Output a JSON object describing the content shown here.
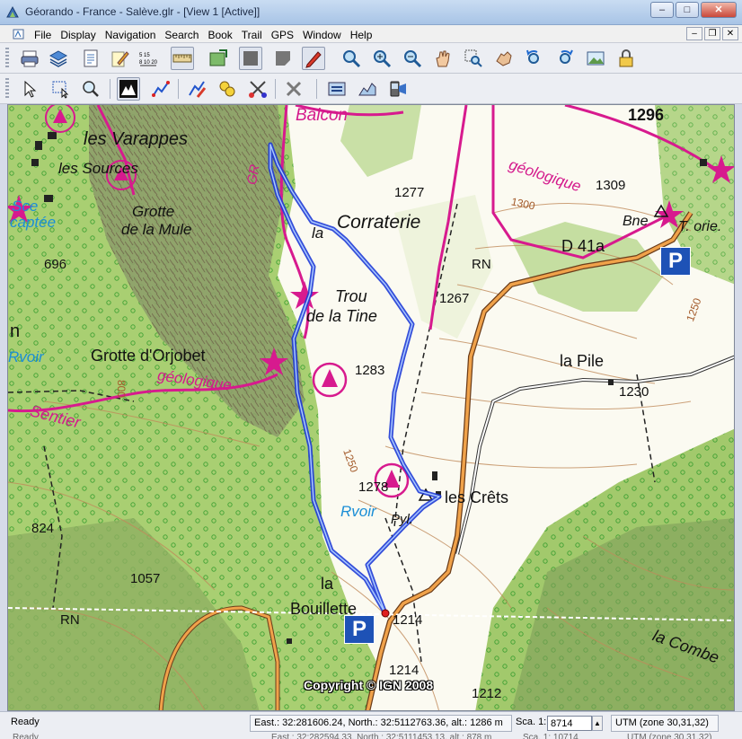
{
  "window": {
    "title": "Géorando - France - Salève.glr - [View 1 [Active]]",
    "minimize": "–",
    "maximize": "□",
    "close": "✕"
  },
  "menubar": {
    "items": [
      "File",
      "Display",
      "Navigation",
      "Search",
      "Book",
      "Trail",
      "GPS",
      "Window",
      "Help"
    ],
    "mdi_minimize": "–",
    "mdi_restore": "❐",
    "mdi_close": "✕"
  },
  "toolbar1": {
    "icons": [
      "print-icon",
      "layers-icon",
      "document-icon",
      "edit-note-icon",
      "scale-icon",
      "ruler-icon",
      "map-download-icon",
      "tile-icon",
      "tile-alt-icon",
      "pencil-icon",
      "zoom-icon",
      "zoom-in-icon",
      "zoom-out-icon",
      "hand-icon",
      "zoom-window-icon",
      "pan-hand-icon",
      "back-icon",
      "forward-icon",
      "picture-icon",
      "lock-icon"
    ]
  },
  "toolbar2": {
    "icons": [
      "pointer-icon",
      "select-rect-icon",
      "magnifier-icon",
      "terrain-icon",
      "track-icon",
      "trail-edit-icon",
      "waypoint-icon",
      "route-cut-icon",
      "delete-icon",
      "transfer-icon",
      "profile-icon",
      "gps-device-icon"
    ]
  },
  "map": {
    "copyright": "Copyright © IGN 2008",
    "labels": [
      {
        "text": "1296",
        "style": "bold"
      },
      {
        "text": "Balcon",
        "style": "magenta"
      },
      {
        "text": "les Varappes",
        "style": "normal"
      },
      {
        "text": "les Sources",
        "style": "normal"
      },
      {
        "text": "Sce",
        "style": "cyan"
      },
      {
        "text": "captée",
        "style": "cyan"
      },
      {
        "text": "Grotte",
        "style": "italic"
      },
      {
        "text": "de la Mule",
        "style": "italic"
      },
      {
        "text": "696",
        "style": "small"
      },
      {
        "text": "GR",
        "style": "magenta"
      },
      {
        "text": "1277",
        "style": "small"
      },
      {
        "text": "Corraterie",
        "style": "italic"
      },
      {
        "text": "la",
        "style": "italic"
      },
      {
        "text": "géologique",
        "style": "magenta"
      },
      {
        "text": "1309",
        "style": "small"
      },
      {
        "text": "1300",
        "style": "brown"
      },
      {
        "text": "Bne",
        "style": "italic"
      },
      {
        "text": "T. orie.",
        "style": "italic"
      },
      {
        "text": "D 41a",
        "style": "normal"
      },
      {
        "text": "RN",
        "style": "small"
      },
      {
        "text": "1267",
        "style": "small"
      },
      {
        "text": "Trou",
        "style": "italic"
      },
      {
        "text": "de la Tine",
        "style": "italic"
      },
      {
        "text": "1250",
        "style": "brown"
      },
      {
        "text": "n",
        "style": "normal"
      },
      {
        "text": "Rvoir",
        "style": "cyan"
      },
      {
        "text": "Grotte d'Orjobet",
        "style": "normal"
      },
      {
        "text": "géologique",
        "style": "magenta"
      },
      {
        "text": "1283",
        "style": "small"
      },
      {
        "text": "la Pile",
        "style": "normal"
      },
      {
        "text": "1230",
        "style": "small"
      },
      {
        "text": "Sentier",
        "style": "magenta"
      },
      {
        "text": "1250",
        "style": "brown"
      },
      {
        "text": "1278",
        "style": "small"
      },
      {
        "text": "les Crêts",
        "style": "normal"
      },
      {
        "text": "Rvoir",
        "style": "cyan"
      },
      {
        "text": "Pyl.",
        "style": "italic"
      },
      {
        "text": "824",
        "style": "small"
      },
      {
        "text": "1057",
        "style": "small"
      },
      {
        "text": "la",
        "style": "normal"
      },
      {
        "text": "Bouillette",
        "style": "normal"
      },
      {
        "text": "1214",
        "style": "small"
      },
      {
        "text": "RN",
        "style": "small"
      },
      {
        "text": "1214",
        "style": "small"
      },
      {
        "text": "1212",
        "style": "small"
      },
      {
        "text": "la Combe",
        "style": "italic"
      },
      {
        "text": "800",
        "style": "brown"
      }
    ],
    "parking_signs": [
      "P",
      "P"
    ]
  },
  "statusbar": {
    "ready": "Ready",
    "coords": "East.: 32:281606.24, North.: 32:5112763.36, alt.: 1286 m",
    "scale_label": "Sca. 1:",
    "scale_value": "8714",
    "spin": "▲",
    "projection": "UTM (zone 30,31,32)",
    "ghost_left": "Ready",
    "ghost_mid": "East.: 32:282594.33, North.: 32:5111453.13, alt.: 878 m",
    "ghost_scale": "Sca. 1: 10714",
    "ghost_proj": "UTM (zone 30,31,32)"
  }
}
